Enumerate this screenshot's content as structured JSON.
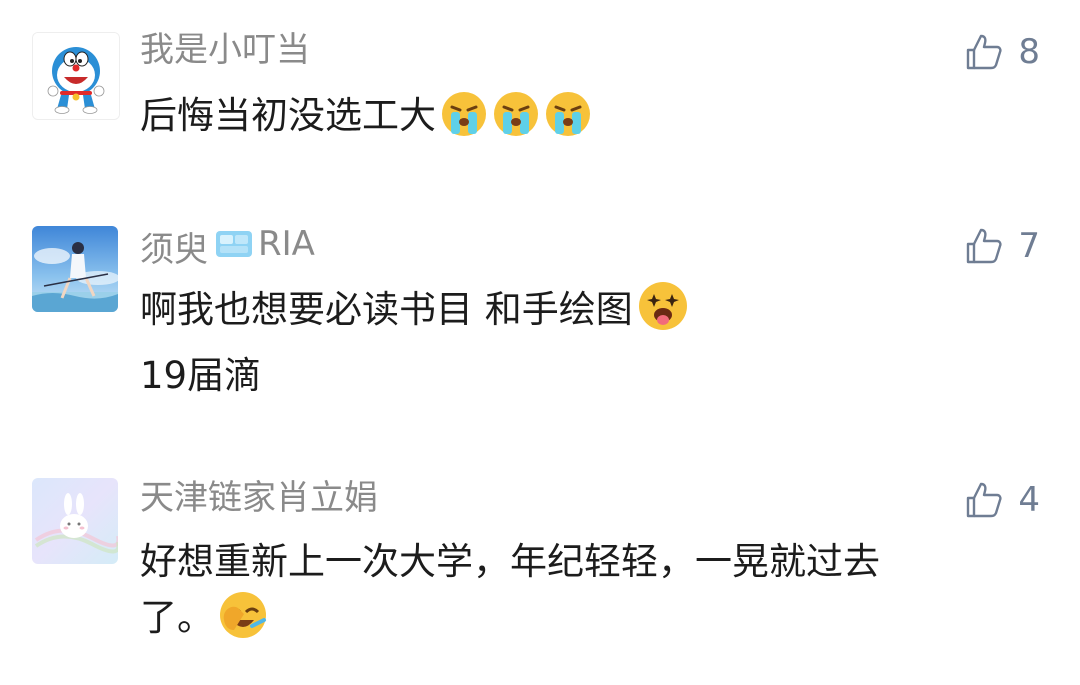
{
  "comments": [
    {
      "user": "我是小叮当",
      "likes": "8",
      "text_lines": [
        "后悔当初没选工大"
      ],
      "emojis": [
        "crying-face-icon",
        "crying-face-icon",
        "crying-face-icon"
      ]
    },
    {
      "user": "须臾",
      "badge_label": "RIA",
      "likes": "7",
      "text_lines": [
        "啊我也想要必读书目 和手绘图",
        "19届滴"
      ],
      "emojis": [
        "star-struck-tongue-face-icon"
      ]
    },
    {
      "user": "天津链家肖立娟",
      "likes": "4",
      "text_lines": [
        "好想重新上一次大学，年纪轻轻，一晃就过去",
        "了。"
      ],
      "emojis": [
        "face-palm-laughing-icon"
      ]
    }
  ]
}
